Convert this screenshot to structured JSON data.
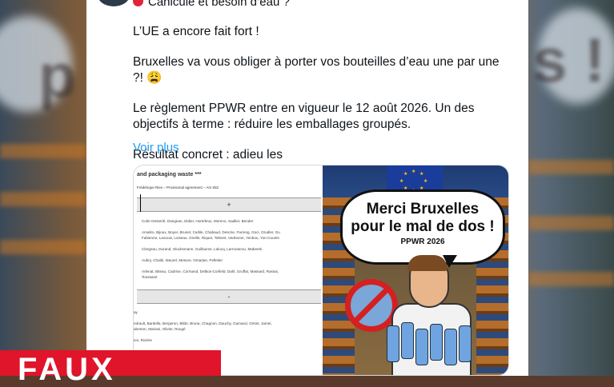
{
  "background": {
    "blur_text_left": "p",
    "blur_text_right": "s !"
  },
  "tweet": {
    "header_text": "Canicule et besoin d’eau ?",
    "paragraphs": [
      "L’UE a encore fait fort !",
      "Bruxelles va vous obliger à porter vos bouteilles d’eau une par une ?! 😩",
      "Le règlement PPWR entre en vigueur le 12 août 2026. Un des objectifs à terme : réduire les emballages groupés.",
      "Résultat concret : adieu les"
    ],
    "see_more": "Voir plus"
  },
  "media": {
    "document": {
      "title": "and packaging waste ***",
      "subtitle": "Frédérique Ries – Provisional agreement – Am 832",
      "plus_sign": "+",
      "minus_sign": "-",
      "lines": [
        "Colin-Oesterlé, Dangean, Didier, Hortefeux, Moreno, Sadlier, Bender",
        "Amaliro, Bijoux, Boyer, Brunet, Carlile, Chabaud, Descrie, Farreng, Goci, Grudler, Gu",
        "Fabienne, Lavocat, Loiseau, Oreille, Riquet, Tolleret, Vedrenne, Yenbou, Yon-Courtin",
        "Clergeau, Durand, Glucksmann, Guillaume, Lalucq, Larrouturou, Maberek",
        "Aubry, Chaibi, Maurel, Mesure, Omarjee, Pelletier",
        "Arlenat, Biteau, Cadrine, Cormand, Delbos-Corfield, Dahl, Gruffat, Massard, Rassai,",
        "Toussaint",
        "ay",
        "ndrault, Bardella, Bergeron, Bilde, Bruna, Chagnon, Dauchy, Gamand, Griset, Jamet,",
        "abreton, Mariani, Olivier, Rougé",
        "ion, Rivière"
      ]
    },
    "illustration": {
      "speech_line1": "Merci Bruxelles",
      "speech_line2": "pour le mal de dos !",
      "speech_tag": "PPWR 2026"
    }
  },
  "verdict_badge": "FAUX",
  "colors": {
    "link": "#1d9bf0",
    "verdict": "#e0142a",
    "text": "#0f1419"
  }
}
